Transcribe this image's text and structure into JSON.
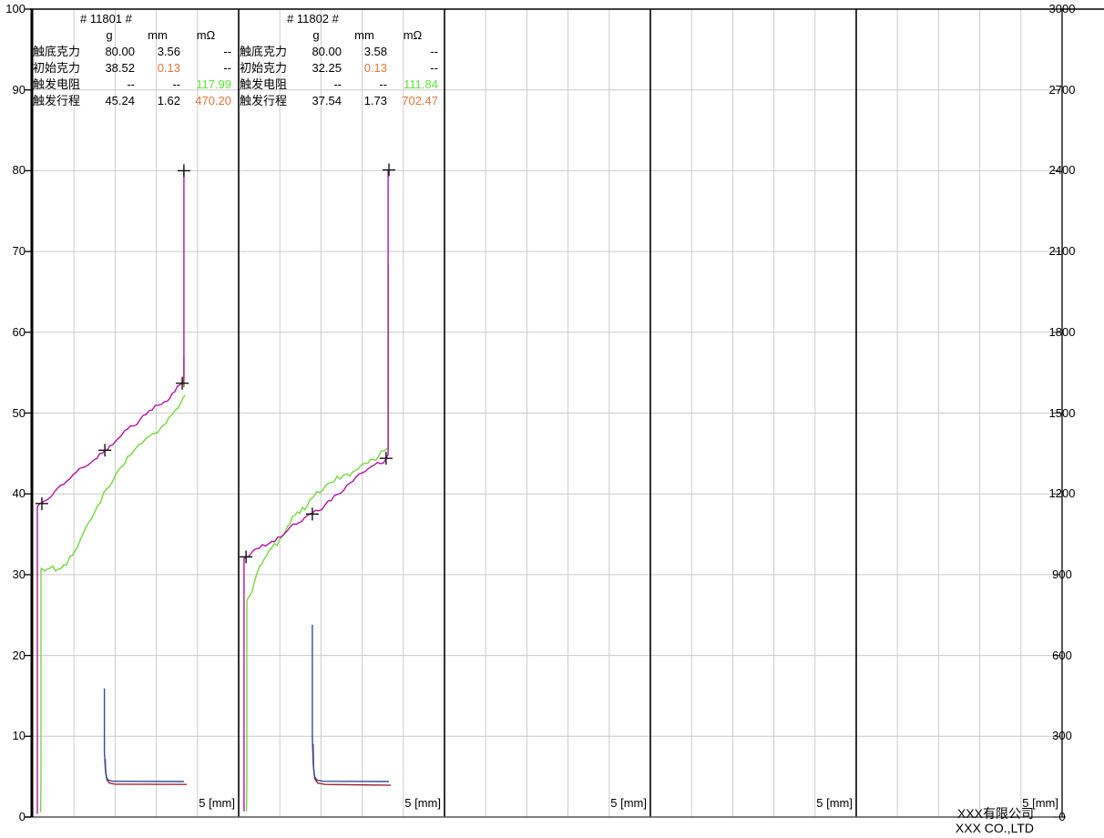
{
  "colors": {
    "accent_orange": "#e2763b",
    "accent_green": "#5ce53a",
    "curve_magenta": "#b214a0",
    "curve_green": "#74d83e",
    "curve_blue": "#2d4f9b",
    "curve_red": "#a12639",
    "curve_olive": "#7c6b14",
    "grid_light": "#cccccc",
    "axis_dark": "#000000"
  },
  "axes": {
    "left_ticks": [
      100,
      90,
      80,
      70,
      60,
      50,
      40,
      30,
      20,
      10,
      0
    ],
    "right_ticks": [
      3000,
      2700,
      2400,
      2100,
      1800,
      1500,
      1200,
      900,
      600,
      300,
      0
    ],
    "x_label": "5 [mm]"
  },
  "footer": {
    "company_cn": "XXX有限公司",
    "company_en": "XXX CO.,LTD"
  },
  "panels_data": [
    {
      "title": "# 11801 #",
      "units": [
        "g",
        "mm",
        "mΩ"
      ],
      "rows": [
        {
          "label": "触底克力",
          "g": "80.00",
          "mm": "3.56",
          "mohm": "--"
        },
        {
          "label": "初始克力",
          "g": "38.52",
          "mm": "0.13",
          "mohm": "--"
        },
        {
          "label": "触发电阻",
          "g": "--",
          "mm": "--",
          "mohm": "117.99"
        },
        {
          "label": "触发行程",
          "g": "45.24",
          "mm": "1.62",
          "mohm": "470.20"
        }
      ]
    },
    {
      "title": "# 11802 #",
      "units": [
        "g",
        "mm",
        "mΩ"
      ],
      "rows": [
        {
          "label": "触底克力",
          "g": "80.00",
          "mm": "3.58",
          "mohm": "--"
        },
        {
          "label": "初始克力",
          "g": "32.25",
          "mm": "0.13",
          "mohm": "--"
        },
        {
          "label": "触发电阻",
          "g": "--",
          "mm": "--",
          "mohm": "111.84"
        },
        {
          "label": "触发行程",
          "g": "37.54",
          "mm": "1.73",
          "mohm": "702.47"
        }
      ]
    }
  ],
  "chart_data": {
    "type": "line",
    "panel_count": 5,
    "x_axis": {
      "unit": "mm",
      "range_per_panel": [
        0,
        5
      ],
      "gridline_every_mm": 1,
      "label": "5 [mm]"
    },
    "y_left_axis": {
      "unit": "g",
      "range": [
        0,
        100
      ],
      "tick_step": 10
    },
    "y_right_axis": {
      "unit": "mΩ",
      "range": [
        0,
        3000
      ],
      "tick_step": 300
    },
    "panels": [
      {
        "index": 0,
        "sample": "# 11801 #",
        "series": [
          {
            "name": "release-resistance",
            "axis": "right",
            "color_key": "curve_red",
            "noise": 0,
            "points": [
              [
                1.76,
                215
              ],
              [
                1.77,
                165
              ],
              [
                1.8,
                138
              ],
              [
                1.86,
                126
              ],
              [
                2.0,
                122
              ],
              [
                3.74,
                121
              ]
            ]
          },
          {
            "name": "press-resistance",
            "axis": "right",
            "color_key": "curve_blue",
            "noise": 0,
            "points": [
              [
                1.74,
                478
              ],
              [
                1.74,
                240
              ],
              [
                1.76,
                180
              ],
              [
                1.79,
                148
              ],
              [
                1.83,
                137
              ],
              [
                1.95,
                133
              ],
              [
                3.67,
                132
              ]
            ]
          },
          {
            "name": "release-force",
            "axis": "left",
            "color_key": "curve_green",
            "noise": 0.5,
            "points": [
              [
                3.7,
                52.2
              ],
              [
                3.6,
                51.2
              ],
              [
                3.45,
                50.3
              ],
              [
                3.3,
                49.6
              ],
              [
                3.1,
                48.3
              ],
              [
                2.9,
                47.6
              ],
              [
                2.74,
                47.0
              ],
              [
                2.5,
                45.6
              ],
              [
                2.3,
                44.8
              ],
              [
                2.1,
                43.0
              ],
              [
                1.86,
                40.8
              ],
              [
                1.65,
                38.9
              ],
              [
                1.42,
                36.9
              ],
              [
                1.25,
                35.3
              ],
              [
                1.08,
                33.5
              ],
              [
                0.9,
                32.4
              ],
              [
                0.75,
                31.2
              ],
              [
                0.55,
                30.3
              ],
              [
                0.42,
                30.6
              ],
              [
                0.21,
                30.7
              ],
              [
                0.2,
                30.7
              ],
              [
                0.2,
                5.0
              ],
              [
                0.19,
                0.6
              ]
            ]
          },
          {
            "name": "spike-overlap",
            "axis": "left",
            "color_key": "curve_olive",
            "noise": 0,
            "points": [
              [
                3.67,
                53.2
              ],
              [
                3.67,
                57.0
              ]
            ]
          },
          {
            "name": "press-force",
            "axis": "left",
            "color_key": "curve_magenta",
            "noise": 0.35,
            "points": [
              [
                0.11,
                0.4
              ],
              [
                0.11,
                38.4
              ],
              [
                0.22,
                38.8
              ],
              [
                0.35,
                39.3
              ],
              [
                0.6,
                40.6
              ],
              [
                0.9,
                41.9
              ],
              [
                1.2,
                43.2
              ],
              [
                1.5,
                44.4
              ],
              [
                1.75,
                45.4
              ],
              [
                2.0,
                46.6
              ],
              [
                2.3,
                47.9
              ],
              [
                2.6,
                49.1
              ],
              [
                2.9,
                50.3
              ],
              [
                3.2,
                51.5
              ],
              [
                3.45,
                52.5
              ],
              [
                3.63,
                53.7
              ],
              [
                3.67,
                54.2
              ],
              [
                3.67,
                80.0
              ]
            ]
          }
        ],
        "markers": [
          [
            0.22,
            38.8
          ],
          [
            1.75,
            45.4
          ],
          [
            3.63,
            53.7
          ],
          [
            3.67,
            80.0
          ]
        ]
      },
      {
        "index": 1,
        "sample": "# 11802 #",
        "series": [
          {
            "name": "release-resistance",
            "axis": "right",
            "color_key": "curve_red",
            "noise": 0,
            "points": [
              [
                1.81,
                271
              ],
              [
                1.82,
                180
              ],
              [
                1.85,
                142
              ],
              [
                1.92,
                126
              ],
              [
                2.1,
                121
              ],
              [
                3.7,
                118
              ]
            ]
          },
          {
            "name": "press-resistance",
            "axis": "right",
            "color_key": "curve_blue",
            "noise": 0,
            "points": [
              [
                1.79,
                714
              ],
              [
                1.79,
                300
              ],
              [
                1.81,
                200
              ],
              [
                1.84,
                152
              ],
              [
                1.9,
                137
              ],
              [
                2.05,
                133
              ],
              [
                3.65,
                132
              ]
            ]
          },
          {
            "name": "release-force",
            "axis": "left",
            "color_key": "curve_green",
            "noise": 0.5,
            "points": [
              [
                3.64,
                68.4
              ],
              [
                3.64,
                45.6
              ],
              [
                3.54,
                45.2
              ],
              [
                3.4,
                44.6
              ],
              [
                3.14,
                43.9
              ],
              [
                2.9,
                43.2
              ],
              [
                2.77,
                42.8
              ],
              [
                2.55,
                42.4
              ],
              [
                2.39,
                42.2
              ],
              [
                2.1,
                41.0
              ],
              [
                1.9,
                40.2
              ],
              [
                1.73,
                39.5
              ],
              [
                1.55,
                38.4
              ],
              [
                1.37,
                37.2
              ],
              [
                1.18,
                35.9
              ],
              [
                1.0,
                34.6
              ],
              [
                0.8,
                33.3
              ],
              [
                0.62,
                32.0
              ],
              [
                0.51,
                30.9
              ],
              [
                0.38,
                29.0
              ],
              [
                0.27,
                27.3
              ],
              [
                0.2,
                26.7
              ],
              [
                0.2,
                4.2
              ],
              [
                0.19,
                0.7
              ]
            ]
          },
          {
            "name": "press-force",
            "axis": "left",
            "color_key": "curve_magenta",
            "noise": 0.35,
            "points": [
              [
                0.13,
                0.7
              ],
              [
                0.13,
                32.0
              ],
              [
                0.18,
                32.2
              ],
              [
                0.3,
                32.6
              ],
              [
                0.5,
                33.2
              ],
              [
                0.8,
                34.1
              ],
              [
                1.1,
                35.1
              ],
              [
                1.4,
                36.2
              ],
              [
                1.79,
                37.5
              ],
              [
                2.1,
                38.7
              ],
              [
                2.4,
                40.0
              ],
              [
                2.7,
                41.3
              ],
              [
                3.0,
                42.6
              ],
              [
                3.3,
                43.6
              ],
              [
                3.58,
                44.4
              ],
              [
                3.63,
                44.9
              ],
              [
                3.63,
                80.1
              ]
            ]
          }
        ],
        "markers": [
          [
            0.18,
            32.2
          ],
          [
            1.79,
            37.5
          ],
          [
            3.58,
            44.4
          ],
          [
            3.65,
            80.1
          ]
        ]
      },
      {
        "index": 2,
        "series": [],
        "markers": []
      },
      {
        "index": 3,
        "series": [],
        "markers": []
      },
      {
        "index": 4,
        "series": [],
        "markers": []
      }
    ]
  }
}
